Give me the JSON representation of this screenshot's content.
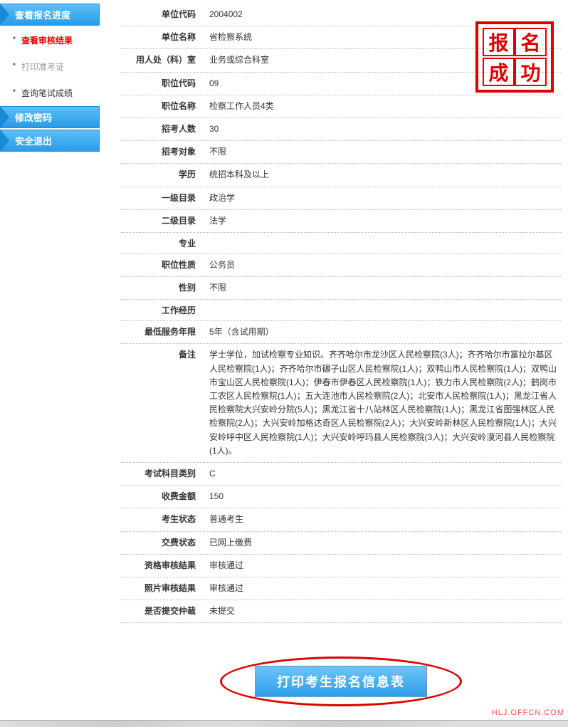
{
  "sidebar": {
    "group1": "查看报名进度",
    "items1": [
      {
        "label": "查看审核结果",
        "style": "red"
      },
      {
        "label": "打印准考证",
        "style": "gray"
      },
      {
        "label": "查询笔试成绩",
        "style": ""
      }
    ],
    "group2": "修改密码",
    "group3": "安全退出"
  },
  "stamp": [
    "报",
    "名",
    "成",
    "功"
  ],
  "fields": [
    {
      "label": "单位代码",
      "value": "2004002"
    },
    {
      "label": "单位名称",
      "value": "省检察系统"
    },
    {
      "label": "用人处（科）室",
      "value": "业务或综合科室"
    },
    {
      "label": "职位代码",
      "value": "09"
    },
    {
      "label": "职位名称",
      "value": "检察工作人员4类"
    },
    {
      "label": "招考人数",
      "value": "30"
    },
    {
      "label": "招考对象",
      "value": "不限"
    },
    {
      "label": "学历",
      "value": "统招本科及以上"
    },
    {
      "label": "一级目录",
      "value": "政治学"
    },
    {
      "label": "二级目录",
      "value": "法学"
    },
    {
      "label": "专业",
      "value": ""
    },
    {
      "label": "职位性质",
      "value": "公务员"
    },
    {
      "label": "性别",
      "value": "不限"
    },
    {
      "label": "工作经历",
      "value": ""
    },
    {
      "label": "最低服务年限",
      "value": "5年（含试用期）"
    },
    {
      "label": "备注",
      "value": "学士学位，加试检察专业知识。齐齐哈尔市龙沙区人民检察院(3人)；齐齐哈尔市富拉尔基区人民检察院(1人)；齐齐哈尔市碾子山区人民检察院(1人)；双鸭山市人民检察院(1人)；双鸭山市宝山区人民检察院(1人)；伊春市伊春区人民检察院(1人)；铁力市人民检察院(2人)；鹤岗市工农区人民检察院(1人)；五大连池市人民检察院(2人)；北安市人民检察院(1人)；黑龙江省人民检察院大兴安岭分院(5人)；黑龙江省十八站林区人民检察院(1人)；黑龙江省图强林区人民检察院(2人)；大兴安岭加格达奇区人民检察院(2人)；大兴安岭新林区人民检察院(1人)；大兴安岭呼中区人民检察院(1人)；大兴安岭呼玛县人民检察院(3人)；大兴安岭漠河县人民检察院(1人)。"
    },
    {
      "label": "考试科目类别",
      "value": "C"
    },
    {
      "label": "收费金额",
      "value": "150"
    },
    {
      "label": "考生状态",
      "value": "普通考生"
    },
    {
      "label": "交费状态",
      "value": "已网上缴费"
    },
    {
      "label": "资格审核结果",
      "value": "审核通过"
    },
    {
      "label": "照片审核结果",
      "value": "审核通过"
    },
    {
      "label": "是否提交仲裁",
      "value": "未提交"
    }
  ],
  "print_button": "打印考生报名信息表",
  "watermark": "HLJ.OFFCN.COM"
}
